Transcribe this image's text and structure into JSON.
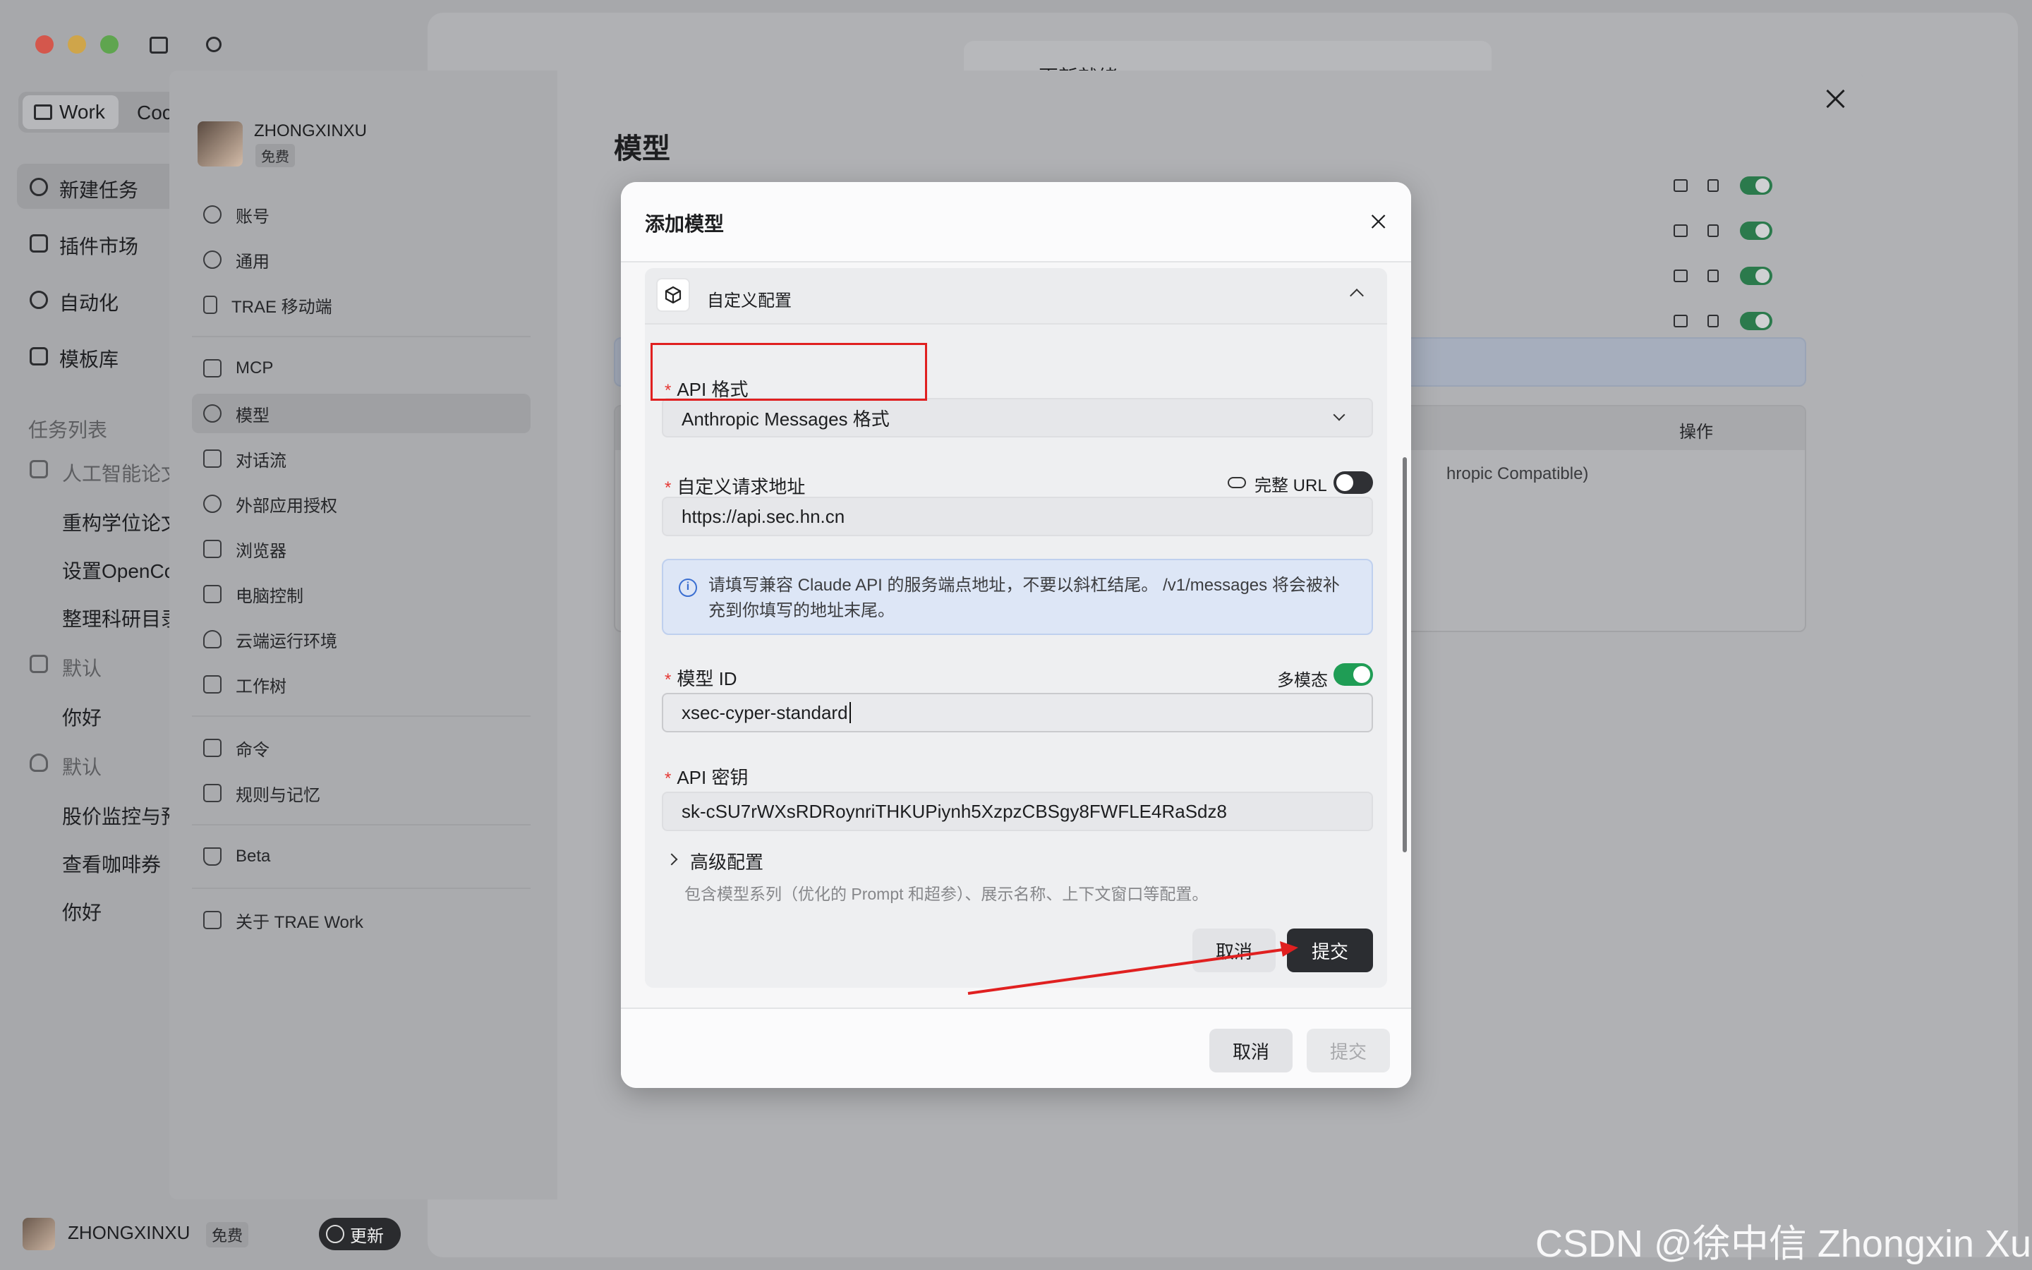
{
  "app": {
    "tab_work": "Work",
    "tab_code": "Coc",
    "nav": [
      {
        "label": "新建任务",
        "icon": "plus-circle-icon"
      },
      {
        "label": "插件市场",
        "icon": "grid-icon"
      },
      {
        "label": "自动化",
        "icon": "clock-icon"
      },
      {
        "label": "模板库",
        "icon": "template-icon"
      }
    ],
    "task_list_title": "任务列表",
    "folders": [
      {
        "label": "人工智能论文",
        "items": [
          "重构学位论文",
          "设置OpenCo",
          "整理科研目录"
        ]
      },
      {
        "label": "默认",
        "items": [
          "你好"
        ]
      },
      {
        "label": "默认",
        "items": [
          "股价监控与预",
          "查看咖啡券",
          "你好"
        ]
      }
    ],
    "user_name": "ZHONGXINXU",
    "user_plan": "免费",
    "update_label": "更新",
    "banner_text": "更新就绪"
  },
  "settings": {
    "user_name": "ZHONGXINXU",
    "user_plan": "免费",
    "nav": [
      {
        "label": "账号",
        "icon": "user-circle-icon"
      },
      {
        "label": "通用",
        "icon": "gear-icon"
      },
      {
        "label": "TRAE 移动端",
        "icon": "phone-icon"
      },
      {
        "label": "MCP",
        "icon": "wrench-icon"
      },
      {
        "label": "模型",
        "icon": "model-icon"
      },
      {
        "label": "对话流",
        "icon": "chat-icon"
      },
      {
        "label": "外部应用授权",
        "icon": "user-key-icon"
      },
      {
        "label": "浏览器",
        "icon": "browser-icon"
      },
      {
        "label": "电脑控制",
        "icon": "monitor-icon"
      },
      {
        "label": "云端运行环境",
        "icon": "cloud-icon"
      },
      {
        "label": "工作树",
        "icon": "worktree-icon"
      },
      {
        "label": "命令",
        "icon": "command-icon"
      },
      {
        "label": "规则与记忆",
        "icon": "book-icon"
      },
      {
        "label": "Beta",
        "icon": "flask-icon"
      },
      {
        "label": "关于 TRAE Work",
        "icon": "info-card-icon"
      }
    ],
    "page_title": "模型",
    "table_header_action": "操作",
    "table_row_text": "hropic Compatible)"
  },
  "modal": {
    "title": "添加模型",
    "section_title": "自定义配置",
    "api_format_label": "API 格式",
    "api_format_value": "Anthropic Messages 格式",
    "endpoint_label": "自定义请求地址",
    "full_url_label": "完整 URL",
    "full_url_on": false,
    "endpoint_value": "https://api.sec.hn.cn",
    "info_text": "请填写兼容 Claude API 的服务端点地址，不要以斜杠结尾。 /v1/messages 将会被补充到你填写的地址末尾。",
    "model_id_label": "模型 ID",
    "multimodal_label": "多模态",
    "multimodal_on": true,
    "model_id_value": "xsec-cyper-standard",
    "api_key_label": "API 密钥",
    "api_key_value": "sk-cSU7rWXsRDRoynriTHKUPiynh5XzpzCBSgy8FWFLE4RaSdz8",
    "advanced_label": "高级配置",
    "advanced_desc": "包含模型系列（优化的 Prompt 和超参）、展示名称、上下文窗口等配置。",
    "inner_cancel": "取消",
    "inner_submit": "提交",
    "footer_cancel": "取消",
    "footer_submit": "提交"
  },
  "watermark": "CSDN @徐中信 Zhongxin Xu",
  "colors": {
    "accent_green": "#1f9d55",
    "annotation_red": "#e02020",
    "dark_button": "#2b2d31"
  }
}
